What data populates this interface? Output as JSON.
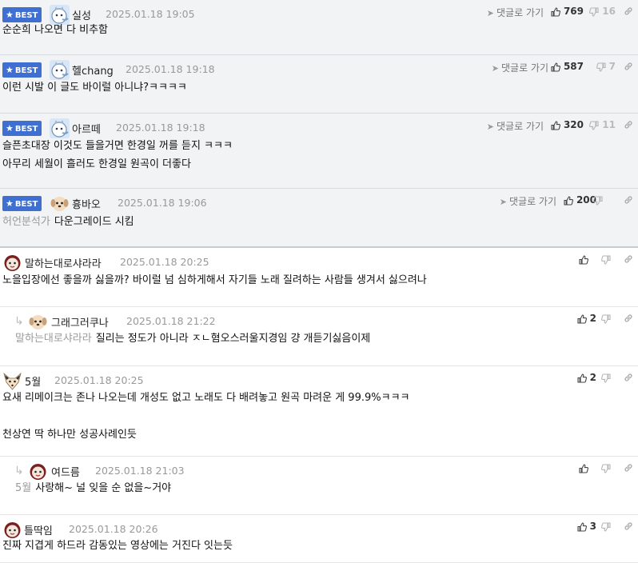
{
  "labels": {
    "best": "BEST",
    "reply_link": "댓글로 가기"
  },
  "comments": [
    {
      "best": true,
      "nick": "실성",
      "date": "2025.01.18 19:05",
      "up": "769",
      "down": "16",
      "mention": "",
      "lines": [
        "순순희 나오면 다 비추함"
      ],
      "avatar": "blue-cat"
    },
    {
      "best": true,
      "nick": "헬chang",
      "date": "2025.01.18 19:18",
      "up": "587",
      "down": "7",
      "mention": "",
      "lines": [
        "이런 시발 이 글도 바이럴 아니냐?ㅋㅋㅋㅋ"
      ],
      "avatar": "blue-cat"
    },
    {
      "best": true,
      "nick": "아르떼",
      "date": "2025.01.18 19:18",
      "up": "320",
      "down": "11",
      "mention": "",
      "lines": [
        "슬픈초대장 이것도 들을거면 한경일 꺼를 듣지 ㅋㅋㅋ",
        "아무리 세월이 흘러도 한경일 원곡이 더좋다"
      ],
      "avatar": "blue-cat"
    },
    {
      "best": true,
      "nick": "흉바오",
      "date": "2025.01.18 19:06",
      "up": "200",
      "down": "",
      "mention": "허언분석가",
      "lines": [
        "다운그레이드 시킴"
      ],
      "avatar": "puppy"
    },
    {
      "best": false,
      "nick": "말하는대로샤라라",
      "date": "2025.01.18 20:25",
      "up": "",
      "down": "",
      "mention": "",
      "lines": [
        "노을입장에선 좋을까 싫을까? 바이럴 넘 심하게해서 자기들 노래 질려하는 사람들 생겨서 싫으려나"
      ],
      "avatar": "red-face"
    },
    {
      "best": false,
      "reply": true,
      "nick": "그래그러쿠나",
      "date": "2025.01.18 21:22",
      "up": "2",
      "down": "",
      "mention": "말하는대로샤라라",
      "lines": [
        "질리는 정도가 아니라 ㅈㄴ혐오스러울지경임 걍 개듣기싫음이제"
      ],
      "avatar": "puppy"
    },
    {
      "best": false,
      "nick": "5월",
      "date": "2025.01.18 20:25",
      "up": "2",
      "down": "",
      "mention": "",
      "lines": [
        "요새 리메이크는 존나 나오는데 개성도 없고 노래도 다 배려놓고 원곡 마려운 게 99.9%ㅋㅋㅋ",
        "",
        "천상연 딱 하나만 성공사례인듯"
      ],
      "avatar": "fox"
    },
    {
      "best": false,
      "reply": true,
      "nick": "여드름",
      "date": "2025.01.18 21:03",
      "up": "",
      "down": "",
      "mention": "5월",
      "lines": [
        "사랑해~ 널 잊을 순 없을~거야"
      ],
      "avatar": "red-face"
    },
    {
      "best": false,
      "nick": "틀딱임",
      "date": "2025.01.18 20:26",
      "up": "3",
      "down": "",
      "mention": "",
      "lines": [
        "진짜 지겹게 하드라 감동있는 영상에는 거진다 잇는듯"
      ],
      "avatar": "red-face"
    }
  ]
}
